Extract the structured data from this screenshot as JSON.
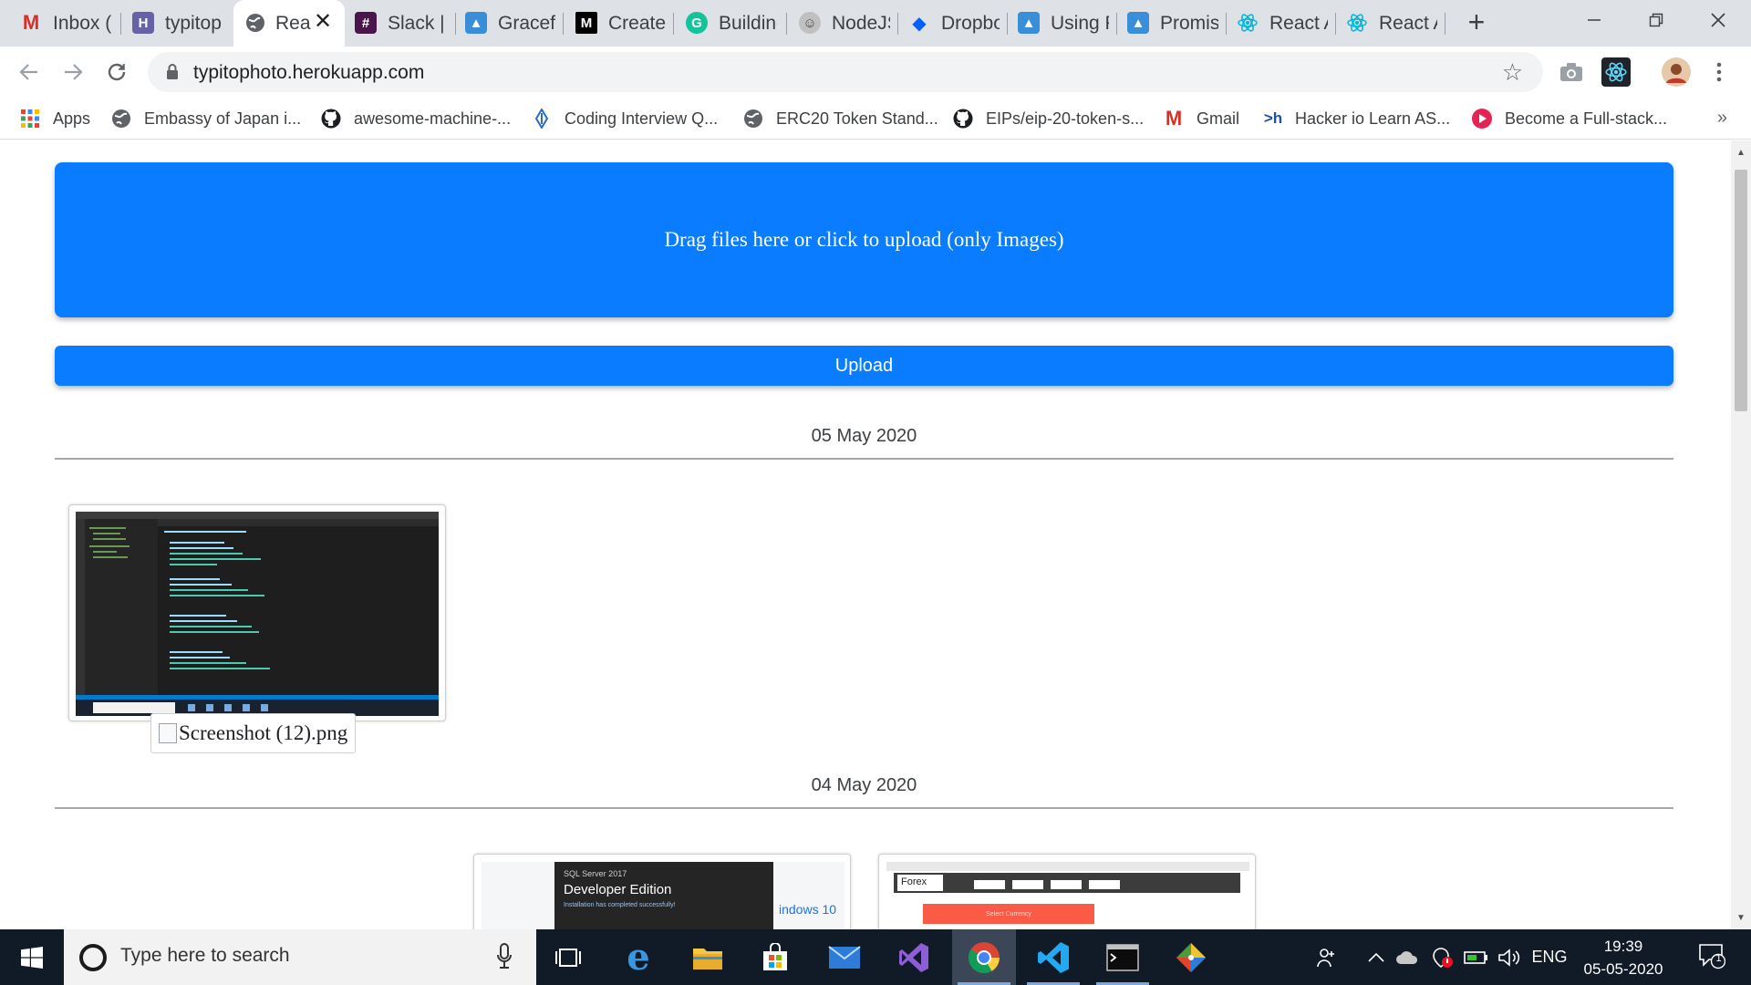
{
  "browser": {
    "tabs": [
      {
        "label": "Inbox (",
        "icon": "gmail-icon",
        "color": "#d93025"
      },
      {
        "label": "typitop",
        "icon": "heroku-icon",
        "color": "#6762a6"
      },
      {
        "label": "Rea",
        "icon": "globe-icon",
        "color": "#5f6368",
        "active": true
      },
      {
        "label": "Slack | ",
        "icon": "slack-icon",
        "color": "#4a154b"
      },
      {
        "label": "Gracefu",
        "icon": "bird-icon",
        "color": "#1b5a8c"
      },
      {
        "label": "Create (",
        "icon": "medium-icon",
        "color": "#000000"
      },
      {
        "label": "Building",
        "icon": "grammarly-icon",
        "color": "#15c39a"
      },
      {
        "label": "NodeJS",
        "icon": "person-icon",
        "color": "#888888"
      },
      {
        "label": "Dropbo",
        "icon": "dropbox-icon",
        "color": "#0061ff"
      },
      {
        "label": "Using P",
        "icon": "bird-icon",
        "color": "#1b5a8c"
      },
      {
        "label": "Promis",
        "icon": "bird-icon",
        "color": "#1b5a8c"
      },
      {
        "label": "React A",
        "icon": "react-icon",
        "color": "#00b4d8"
      },
      {
        "label": "React A",
        "icon": "react-icon",
        "color": "#00b4d8"
      }
    ],
    "close_glyph": "✕",
    "new_tab_glyph": "+",
    "url": "typitophoto.herokuapp.com"
  },
  "bookmarks": [
    {
      "label": "Apps",
      "icon": "apps-grid-icon"
    },
    {
      "label": "Embassy of Japan i...",
      "icon": "globe-icon"
    },
    {
      "label": "awesome-machine-...",
      "icon": "github-icon"
    },
    {
      "label": "Coding Interview Q...",
      "icon": "diamond-icon"
    },
    {
      "label": "ERC20 Token Stand...",
      "icon": "globe-icon"
    },
    {
      "label": "EIPs/eip-20-token-s...",
      "icon": "github-icon"
    },
    {
      "label": "Gmail",
      "icon": "gmail-icon"
    },
    {
      "label": "Hacker io Learn AS...",
      "icon": "hackerio-icon"
    },
    {
      "label": "Become a Full-stack...",
      "icon": "play-icon"
    }
  ],
  "bookmarks_more": "»",
  "page": {
    "dropzone_text": "Drag files here or click to upload (only Images)",
    "upload_label": "Upload",
    "groups": [
      {
        "date": "05 May 2020"
      },
      {
        "date": "04 May 2020"
      }
    ],
    "broken_image_alt": "Screenshot (12).png",
    "sql_title": "SQL Server 2017",
    "sql_edition": "Developer Edition",
    "sql_msg": "Installation has completed successfully!",
    "win10_text": "indows 10",
    "forex_label": "Forex",
    "forex_btn": "Select Currency"
  },
  "taskbar": {
    "search_placeholder": "Type here to search",
    "language": "ENG",
    "time": "19:39",
    "date": "05-05-2020",
    "notification_count": "1"
  },
  "colors": {
    "accent": "#0a7cff",
    "taskbar": "#111a27"
  }
}
